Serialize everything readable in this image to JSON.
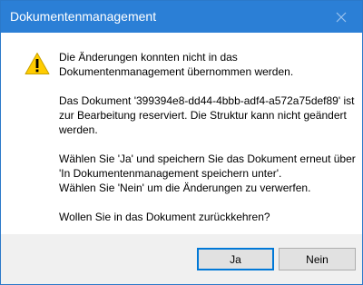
{
  "window": {
    "title": "Dokumentenmanagement"
  },
  "message": {
    "line1": "Die Änderungen konnten nicht in das",
    "line2": "Dokumentenmanagement übernommen werden.",
    "para2_line1": "Das Dokument '399394e8-dd44-4bbb-adf4-a572a75def89' ist",
    "para2_line2": "zur Bearbeitung reserviert. Die Struktur kann nicht geändert",
    "para2_line3": "werden.",
    "para3_line1": "Wählen Sie 'Ja' und speichern Sie das Dokument erneut über",
    "para3_line2": "'In Dokumentenmanagement speichern unter'.",
    "para3_line3": "Wählen Sie 'Nein' um die Änderungen zu verwerfen.",
    "question": "Wollen Sie in das Dokument zurückkehren?"
  },
  "buttons": {
    "yes_label": "Ja",
    "no_label": "Nein"
  },
  "icons": {
    "warning": "warning-icon",
    "close": "close-icon"
  },
  "colors": {
    "titlebar": "#2b7fd6",
    "footer": "#f0f0f0",
    "primary_button_border": "#0078d7",
    "warning_fill": "#ffcc00"
  }
}
